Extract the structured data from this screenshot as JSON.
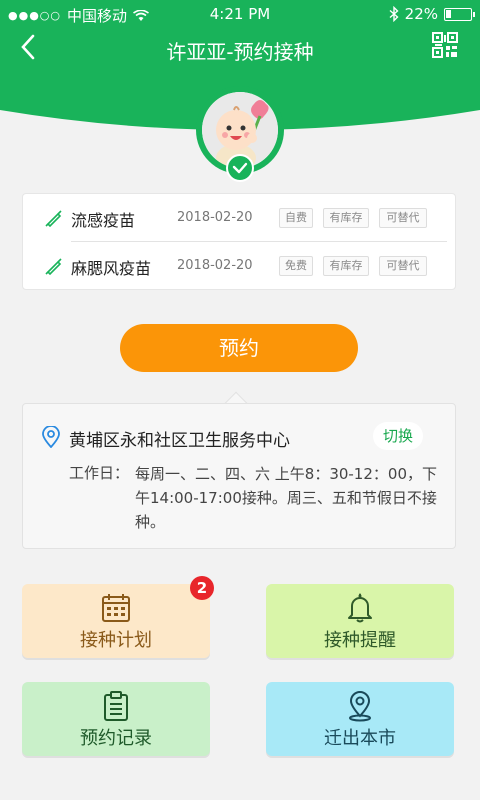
{
  "status_bar": {
    "carrier": "中国移动",
    "time": "4:21 PM",
    "battery": "22%",
    "battery_level": 0.22
  },
  "nav": {
    "title": "许亚亚-预约接种"
  },
  "vaccines": [
    {
      "name": "流感疫苗",
      "date": "2018-02-20",
      "tags": [
        "自费",
        "有库存",
        "可替代"
      ]
    },
    {
      "name": "麻腮风疫苗",
      "date": "2018-02-20",
      "tags": [
        "免费",
        "有库存",
        "可替代"
      ]
    }
  ],
  "reserve_label": "预约",
  "clinic": {
    "name": "黄埔区永和社区卫生服务中心",
    "switch_label": "切换",
    "hours_label": "工作日：",
    "hours_text": "每周一、二、四、六 上午8：30-12：00，下午14:00-17:00接种。周三、五和节假日不接种。"
  },
  "tiles": [
    {
      "label": "接种计划",
      "icon": "calendar-icon",
      "badge": "2",
      "color": "#8a5a1a"
    },
    {
      "label": "接种提醒",
      "icon": "bell-icon",
      "color": "#2f5a2a"
    },
    {
      "label": "预约记录",
      "icon": "clipboard-icon",
      "color": "#1f5a2a"
    },
    {
      "label": "迁出本市",
      "icon": "location-pin-icon",
      "color": "#1a4a5a"
    }
  ],
  "colors": {
    "brand_green": "#19b35a",
    "orange": "#fb9508",
    "badge_red": "#e8262b"
  }
}
